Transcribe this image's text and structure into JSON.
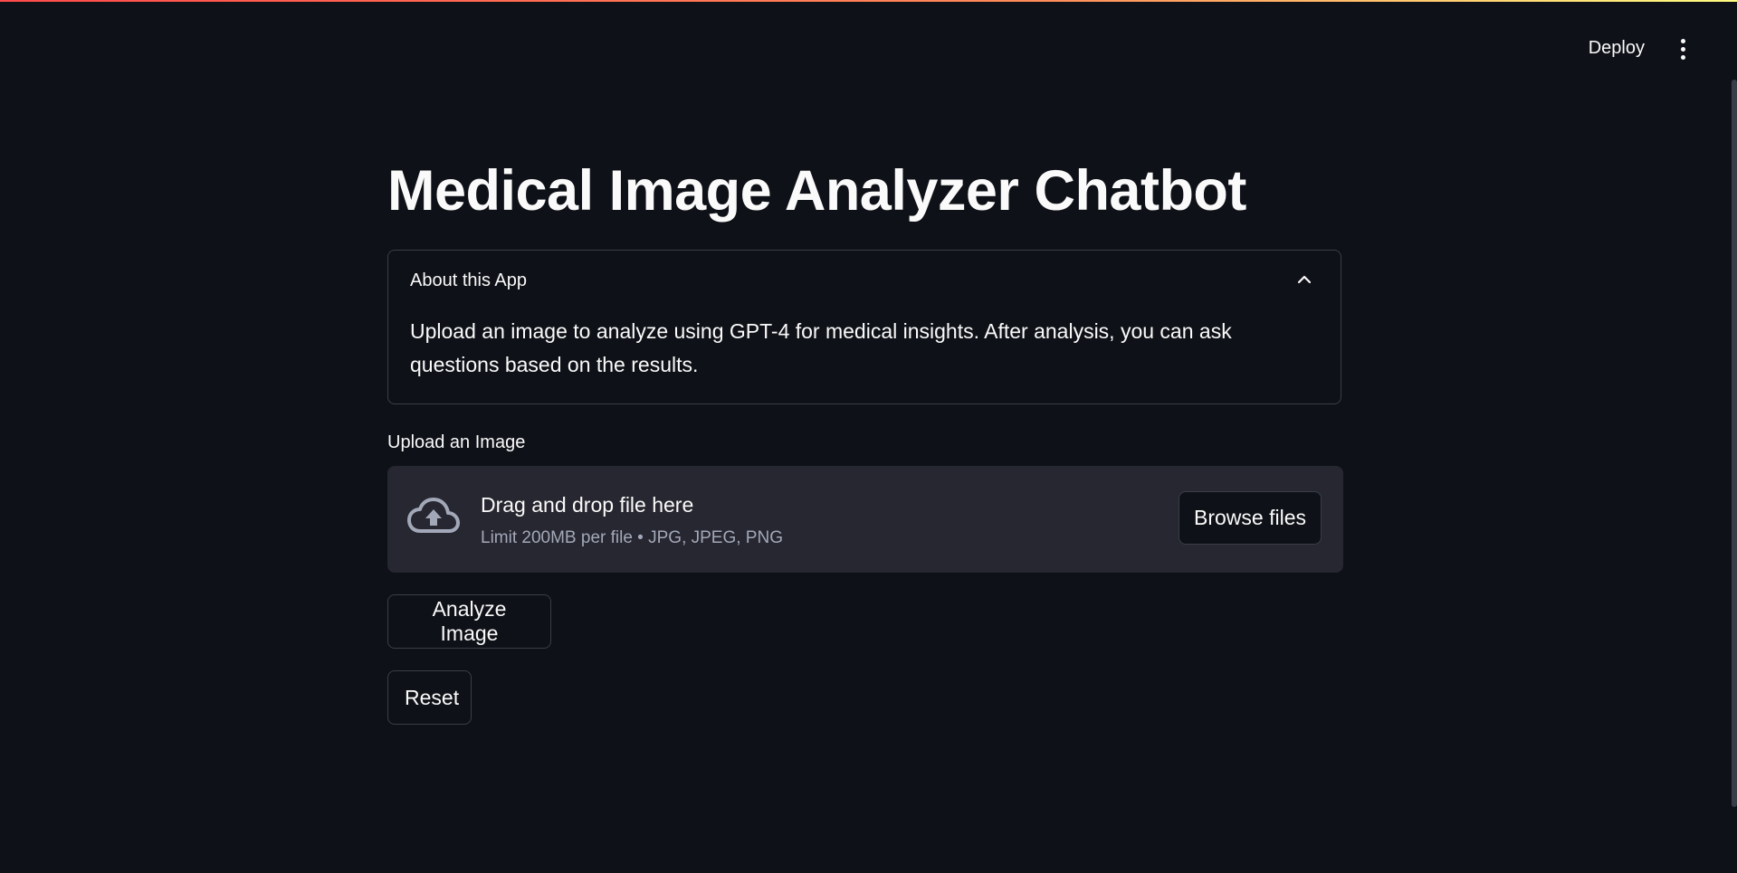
{
  "header": {
    "deploy_label": "Deploy",
    "menu_icon": "more-vertical-icon"
  },
  "main": {
    "title": "Medical Image Analyzer Chatbot",
    "expander": {
      "label": "About this App",
      "icon": "chevron-up-icon",
      "body": "Upload an image to analyze using GPT-4 for medical insights. After analysis, you can ask questions based on the results."
    },
    "uploader": {
      "label": "Upload an Image",
      "icon": "cloud-upload-icon",
      "dropzone_title": "Drag and drop file here",
      "limit_text": "Limit 200MB per file • JPG, JPEG, PNG",
      "browse_label": "Browse files"
    },
    "analyze_label": "Analyze Image",
    "reset_label": "Reset"
  },
  "colors": {
    "background": "#0e1117",
    "dropzone": "#262730",
    "border": "#3b3e47",
    "text": "#fafafa",
    "muted_text": "#a3a8b8",
    "accent_gradient_start": "#ff4b4b",
    "accent_gradient_end": "#fffd80"
  }
}
